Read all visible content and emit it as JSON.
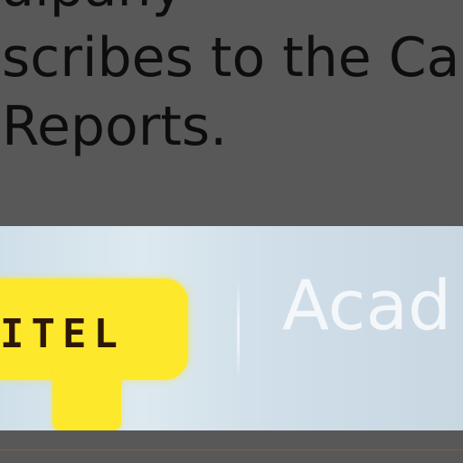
{
  "article": {
    "line_top": "uipany",
    "line_1": "scribes to the Ca",
    "line_2": "Reports."
  },
  "banner": {
    "logo_text": "ITEL",
    "brand_text": "Acad",
    "colors": {
      "logo_yellow": "#fde82b",
      "logo_text": "#2d1708",
      "brand_text": "#f4f7fa",
      "banner_bg": "#d3e1ea"
    }
  }
}
